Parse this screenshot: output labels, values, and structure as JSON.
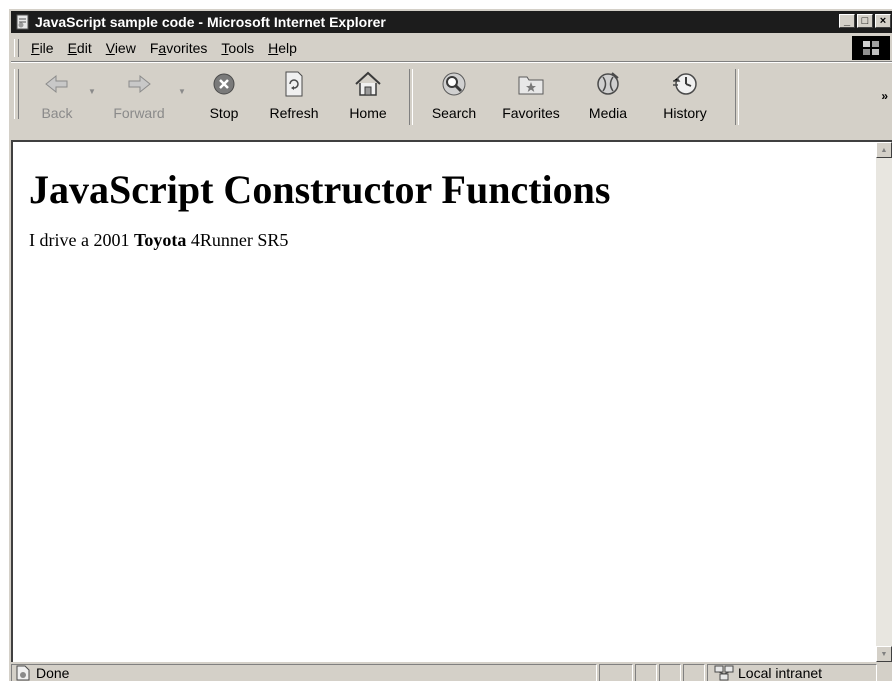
{
  "window": {
    "title": "JavaScript sample code - Microsoft Internet Explorer"
  },
  "title_buttons": {
    "minimize": "_",
    "maximize": "□",
    "close": "×"
  },
  "menu": {
    "items": [
      {
        "label_prefix": "",
        "accel": "F",
        "label_suffix": "ile"
      },
      {
        "label_prefix": "",
        "accel": "E",
        "label_suffix": "dit"
      },
      {
        "label_prefix": "",
        "accel": "V",
        "label_suffix": "iew"
      },
      {
        "label_prefix": "F",
        "accel": "a",
        "label_suffix": "vorites"
      },
      {
        "label_prefix": "",
        "accel": "T",
        "label_suffix": "ools"
      },
      {
        "label_prefix": "",
        "accel": "H",
        "label_suffix": "elp"
      }
    ]
  },
  "toolbar": {
    "back": "Back",
    "forward": "Forward",
    "stop": "Stop",
    "refresh": "Refresh",
    "home": "Home",
    "search": "Search",
    "favorites": "Favorites",
    "media": "Media",
    "history": "History",
    "more": "»"
  },
  "page": {
    "heading": "JavaScript Constructor Functions",
    "sentence_before": "I drive a 2001 ",
    "sentence_bold": "Toyota",
    "sentence_after": " 4Runner SR5"
  },
  "statusbar": {
    "status_text": "Done",
    "zone_text": "Local intranet"
  },
  "icons": {
    "title": "ie-page-icon",
    "back": "back-arrow-icon",
    "forward": "forward-arrow-icon",
    "stop": "stop-icon",
    "refresh": "refresh-icon",
    "home": "home-icon",
    "search": "search-icon",
    "favorites": "favorites-folder-icon",
    "media": "media-icon",
    "history": "history-icon",
    "status": "page-done-icon",
    "zone": "local-intranet-icon"
  }
}
